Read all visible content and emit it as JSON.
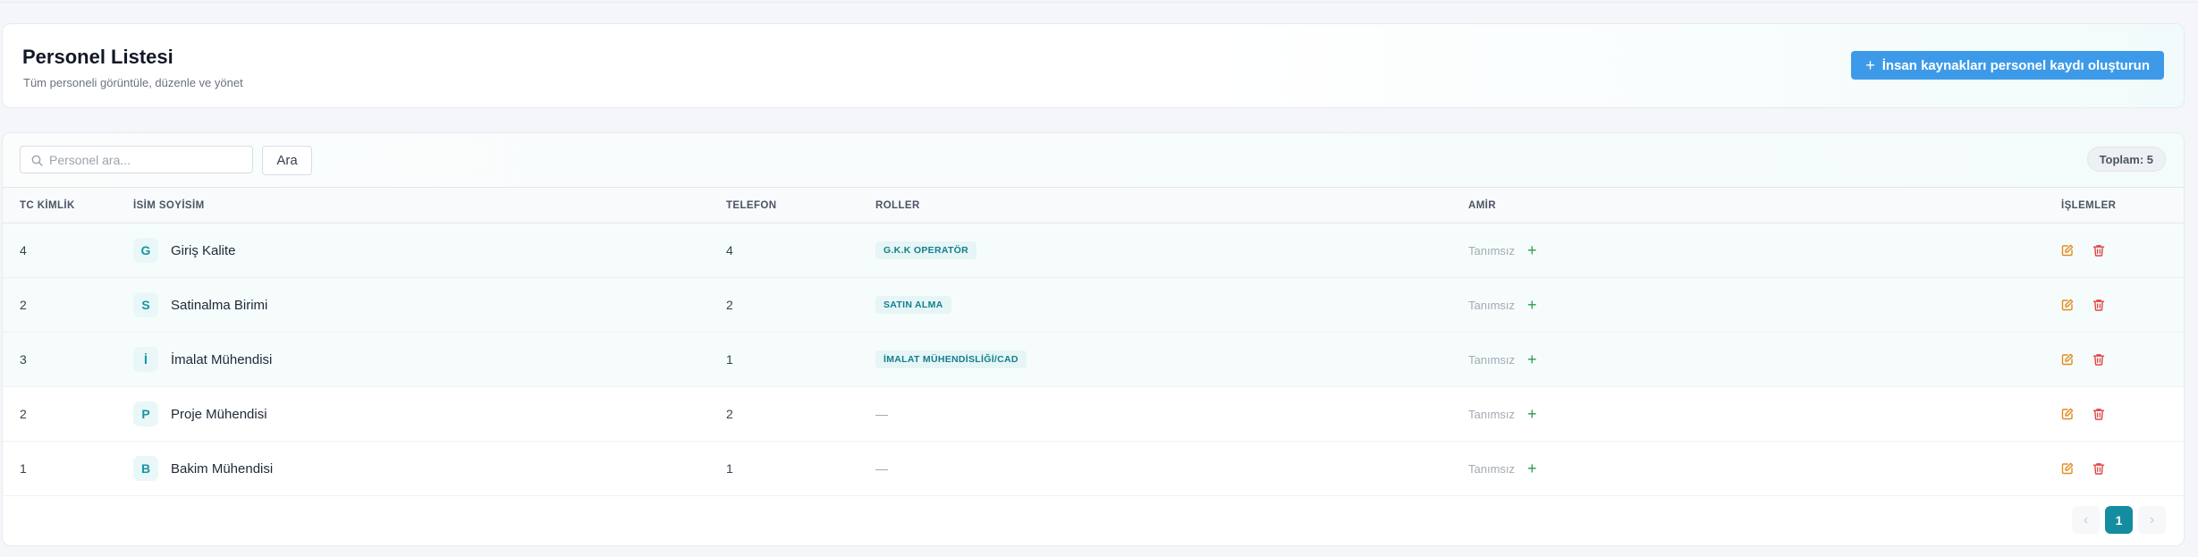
{
  "header": {
    "title": "Personel Listesi",
    "subtitle": "Tüm personeli görüntüle, düzenle ve yönet",
    "create_button_label": "İnsan kaynakları personel kaydı oluşturun"
  },
  "toolbar": {
    "search_placeholder": "Personel ara...",
    "search_value": "",
    "search_button_label": "Ara",
    "total_label": "Toplam: 5"
  },
  "table": {
    "columns": [
      "TC KİMLİK",
      "İSİM SOYİSİM",
      "TELEFON",
      "ROLLER",
      "AMİR",
      "İŞLEMLER"
    ],
    "rows": [
      {
        "tc": "4",
        "initial": "G",
        "name": "Giriş Kalite",
        "phone": "4",
        "role": "G.K.K OPERATÖR",
        "amir": "Tanımsız"
      },
      {
        "tc": "2",
        "initial": "S",
        "name": "Satinalma Birimi",
        "phone": "2",
        "role": "SATIN ALMA",
        "amir": "Tanımsız"
      },
      {
        "tc": "3",
        "initial": "İ",
        "name": "İmalat Mühendisi",
        "phone": "1",
        "role": "İMALAT MÜHENDİSLİĞİ/CAD",
        "amir": "Tanımsız"
      },
      {
        "tc": "2",
        "initial": "P",
        "name": "Proje Mühendisi",
        "phone": "2",
        "role": "—",
        "amir": "Tanımsız"
      },
      {
        "tc": "1",
        "initial": "B",
        "name": "Bakim Mühendisi",
        "phone": "1",
        "role": "—",
        "amir": "Tanımsız"
      }
    ]
  },
  "pagination": {
    "current_page": "1",
    "prev_icon": "chevron-left-icon",
    "next_icon": "chevron-right-icon"
  },
  "colors": {
    "primary_button": "#3d9ae8",
    "accent_teal": "#148da1",
    "edit_icon": "#e38a1d",
    "delete_icon": "#e04444",
    "add_icon": "#2f9b4f"
  }
}
